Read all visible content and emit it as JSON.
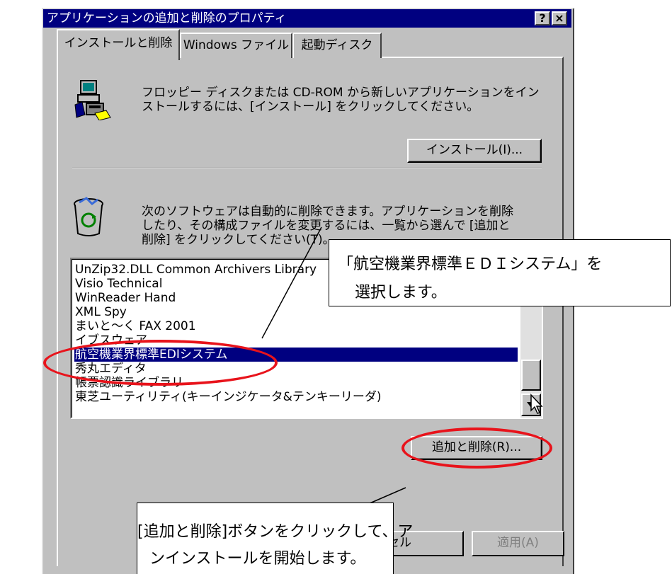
{
  "window": {
    "title": "アプリケーションの追加と削除のプロパティ",
    "help_button": "?",
    "close_button": "×"
  },
  "tabs": [
    {
      "label": "インストールと削除"
    },
    {
      "label": "Windows ファイル"
    },
    {
      "label": "起動ディスク"
    }
  ],
  "install": {
    "description_line1": "フロッピー ディスクまたは CD-ROM から新しいアプリケーションをイン",
    "description_line2": "ストールするには、[インストール] をクリックしてください。",
    "button_label": "インストール(I)..."
  },
  "remove": {
    "description_line1": "次のソフトウェアは自動的に削除できます。アプリケーションを削除",
    "description_line2": "したり、その構成ファイルを変更するには、一覧から選んで [追加と",
    "description_line3": "削除] をクリックしてください(T)。",
    "button_label": "追加と削除(R)..."
  },
  "program_list": {
    "items": [
      "UnZip32.DLL Common Archivers Library",
      "Visio Technical",
      "WinReader Hand",
      "XML Spy",
      "まいと～く FAX 2001",
      "イブスウェア",
      "航空機業界標準EDIシステム",
      "秀丸エディタ",
      "帳票認識ライブラリ",
      "東芝ユーティリティ(キーインジケータ&テンキーリーダ)"
    ],
    "selected_index": 6
  },
  "footer": {
    "cancel_label": "セル",
    "apply_label": "適用(A)"
  },
  "callouts": {
    "select_line1": "「航空機業界標準ＥＤＩシステム」を",
    "select_line2": "選択します。",
    "click_line1": "[追加と削除]ボタンをクリックして、ア",
    "click_line2": "ンインストールを開始します。"
  },
  "colors": {
    "titlebar": "#000080",
    "dialog_face": "#c0c0c0",
    "selection": "#000080",
    "highlight_ellipse": "#e8131b"
  }
}
